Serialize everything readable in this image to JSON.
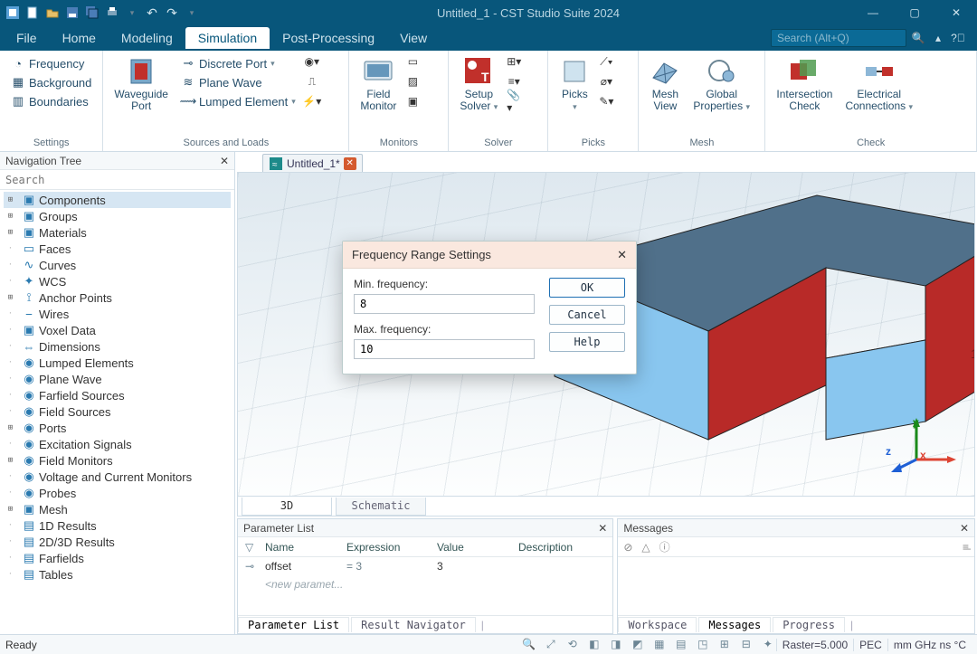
{
  "titlebar": {
    "title": "Untitled_1 - CST Studio Suite 2024"
  },
  "menu": {
    "items": [
      "File",
      "Home",
      "Modeling",
      "Simulation",
      "Post-Processing",
      "View"
    ],
    "active_index": 3,
    "search_placeholder": "Search (Alt+Q)"
  },
  "ribbon": {
    "settings": {
      "label": "Settings",
      "frequency": "Frequency",
      "background": "Background",
      "boundaries": "Boundaries"
    },
    "sources": {
      "label": "Sources and Loads",
      "waveguide_port": "Waveguide\nPort",
      "discrete_port": "Discrete Port",
      "plane_wave": "Plane Wave",
      "lumped_element": "Lumped Element"
    },
    "monitors": {
      "label": "Monitors",
      "field_monitor": "Field\nMonitor"
    },
    "solver": {
      "label": "Solver",
      "setup_solver": "Setup\nSolver"
    },
    "picks": {
      "label": "Picks",
      "picks": "Picks"
    },
    "mesh": {
      "label": "Mesh",
      "mesh_view": "Mesh\nView",
      "global_properties": "Global\nProperties"
    },
    "check": {
      "label": "Check",
      "intersection_check": "Intersection\nCheck",
      "electrical_connections": "Electrical\nConnections"
    }
  },
  "nav": {
    "title": "Navigation Tree",
    "search_placeholder": "Search",
    "items": [
      {
        "label": "Components",
        "exp": "+",
        "depth": 0,
        "icon": "cube",
        "sel": true
      },
      {
        "label": "Groups",
        "exp": "+",
        "depth": 0,
        "icon": "cube"
      },
      {
        "label": "Materials",
        "exp": "+",
        "depth": 0,
        "icon": "cube"
      },
      {
        "label": "Faces",
        "exp": "",
        "depth": 0,
        "icon": "sheet"
      },
      {
        "label": "Curves",
        "exp": "",
        "depth": 0,
        "icon": "curve"
      },
      {
        "label": "WCS",
        "exp": "",
        "depth": 0,
        "icon": "axis"
      },
      {
        "label": "Anchor Points",
        "exp": "+",
        "depth": 0,
        "icon": "anchor"
      },
      {
        "label": "Wires",
        "exp": "",
        "depth": 0,
        "icon": "wire"
      },
      {
        "label": "Voxel Data",
        "exp": "",
        "depth": 0,
        "icon": "cube"
      },
      {
        "label": "Dimensions",
        "exp": "",
        "depth": 0,
        "icon": "dim"
      },
      {
        "label": "Lumped Elements",
        "exp": "",
        "depth": 0,
        "icon": "circle"
      },
      {
        "label": "Plane Wave",
        "exp": "",
        "depth": 0,
        "icon": "circle"
      },
      {
        "label": "Farfield Sources",
        "exp": "",
        "depth": 0,
        "icon": "circle"
      },
      {
        "label": "Field Sources",
        "exp": "",
        "depth": 0,
        "icon": "circle"
      },
      {
        "label": "Ports",
        "exp": "+",
        "depth": 0,
        "icon": "circle"
      },
      {
        "label": "Excitation Signals",
        "exp": "",
        "depth": 0,
        "icon": "circle"
      },
      {
        "label": "Field Monitors",
        "exp": "+",
        "depth": 0,
        "icon": "circle"
      },
      {
        "label": "Voltage and Current Monitors",
        "exp": "",
        "depth": 0,
        "icon": "circle"
      },
      {
        "label": "Probes",
        "exp": "",
        "depth": 0,
        "icon": "circle"
      },
      {
        "label": "Mesh",
        "exp": "+",
        "depth": 0,
        "icon": "cube"
      },
      {
        "label": "1D Results",
        "exp": "",
        "depth": 0,
        "icon": "result"
      },
      {
        "label": "2D/3D Results",
        "exp": "",
        "depth": 0,
        "icon": "result"
      },
      {
        "label": "Farfields",
        "exp": "",
        "depth": 0,
        "icon": "result"
      },
      {
        "label": "Tables",
        "exp": "",
        "depth": 0,
        "icon": "result"
      }
    ]
  },
  "doc_tab": {
    "label": "Untitled_1*"
  },
  "view_tabs": {
    "threeD": "3D",
    "schematic": "Schematic"
  },
  "dialog": {
    "title": "Frequency Range Settings",
    "min_label": "Min. frequency:",
    "min_value": "8",
    "max_label": "Max. frequency:",
    "max_value": "10",
    "ok": "OK",
    "cancel": "Cancel",
    "help": "Help"
  },
  "params": {
    "title": "Parameter List",
    "headers": {
      "name": "Name",
      "expression": "Expression",
      "value": "Value",
      "description": "Description"
    },
    "rows": [
      {
        "name": "offset",
        "expression": "= 3",
        "value": "3",
        "description": ""
      }
    ],
    "new_row": "<new paramet...",
    "tabs": {
      "param_list": "Parameter List",
      "result_nav": "Result Navigator"
    }
  },
  "messages": {
    "title": "Messages",
    "tabs": {
      "workspace": "Workspace",
      "messages": "Messages",
      "progress": "Progress"
    }
  },
  "statusbar": {
    "ready": "Ready",
    "raster": "Raster=5.000",
    "pec": "PEC",
    "units": "mm GHz ns °C"
  }
}
